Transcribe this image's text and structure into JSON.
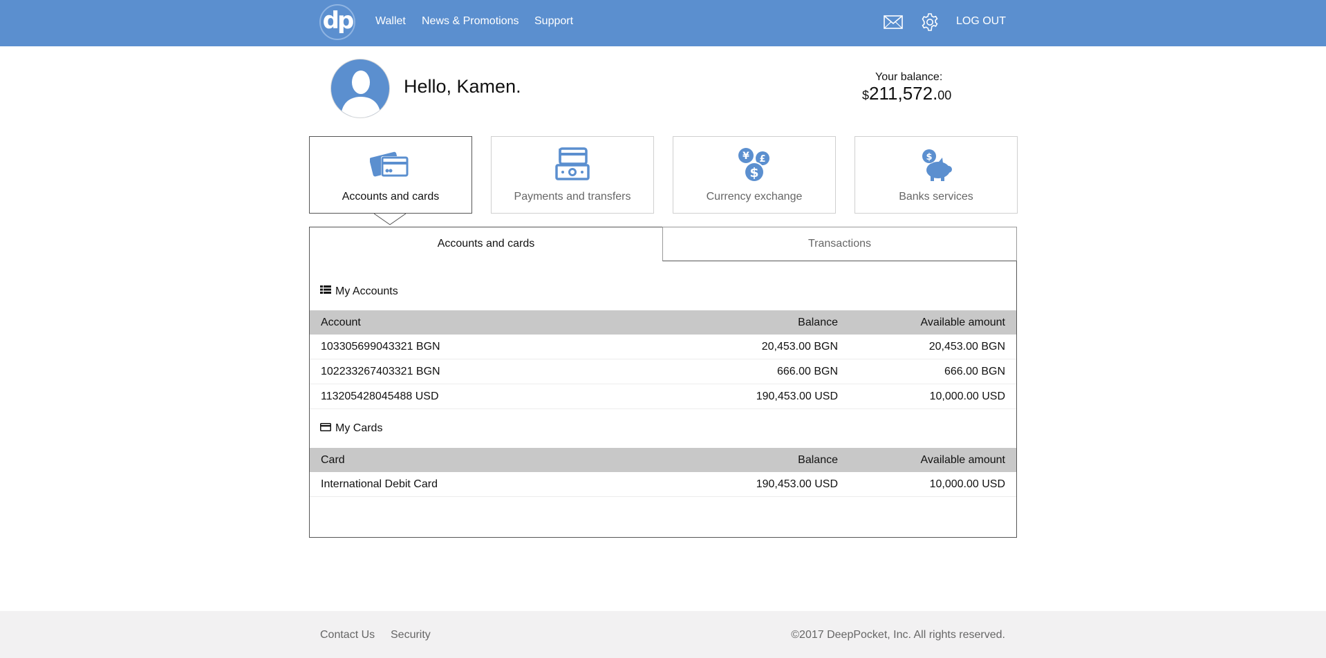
{
  "header": {
    "logo_text": "dp",
    "nav": [
      "Wallet",
      "News & Promotions",
      "Support"
    ],
    "logout_label": "LOG OUT",
    "icons": [
      "mail-icon",
      "gear-icon"
    ],
    "bg_color": "#5b8fcf"
  },
  "profile": {
    "greeting": "Hello, Kamen.",
    "balance_label": "Your balance:",
    "balance_currency": "$",
    "balance_whole": "211,572.",
    "balance_cents": "00"
  },
  "services": [
    {
      "label": "Accounts and cards",
      "icon": "cards-icon",
      "active": true
    },
    {
      "label": "Payments and transfers",
      "icon": "payments-icon",
      "active": false
    },
    {
      "label": "Currency exchange",
      "icon": "currency-icon",
      "active": false
    },
    {
      "label": "Banks services",
      "icon": "piggy-bank-icon",
      "active": false
    }
  ],
  "tabs": {
    "active": "Accounts and cards",
    "inactive": "Transactions"
  },
  "accounts": {
    "title": "My Accounts",
    "columns": [
      "Account",
      "Balance",
      "Available amount"
    ],
    "rows": [
      [
        "103305699043321 BGN",
        "20,453.00 BGN",
        "20,453.00 BGN"
      ],
      [
        "102233267403321 BGN",
        "666.00 BGN",
        "666.00 BGN"
      ],
      [
        "113205428045488 USD",
        "190,453.00 USD",
        "10,000.00 USD"
      ]
    ]
  },
  "cards": {
    "title": "My Cards",
    "columns": [
      "Card",
      "Balance",
      "Available amount"
    ],
    "rows": [
      [
        "International Debit Card",
        "190,453.00 USD",
        "10,000.00 USD"
      ]
    ]
  },
  "footer": {
    "links": [
      "Contact Us",
      "Security"
    ],
    "copyright": "©2017 DeepPocket, Inc. All rights reserved."
  }
}
